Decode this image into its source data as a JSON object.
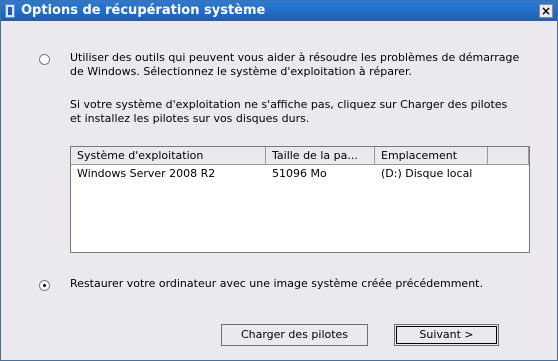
{
  "window": {
    "title": "Options de récupération système",
    "close_label": "×"
  },
  "option1": {
    "selected": false,
    "lines": [
      "Utiliser des outils qui peuvent vous aider à résoudre les problèmes de démarrage",
      "de Windows. Sélectionnez le système d'exploitation à réparer."
    ],
    "note_lines": [
      "Si votre système d'exploitation ne s'affiche pas, cliquez sur Charger des pilotes",
      "et installez les pilotes sur vos disques durs."
    ]
  },
  "os_list": {
    "columns": [
      "Système d'exploitation",
      "Taille de la pa...",
      "Emplacement"
    ],
    "rows": [
      [
        "Windows Server 2008 R2",
        "51096 Mo",
        "(D:) Disque local"
      ]
    ]
  },
  "option2": {
    "selected": true,
    "label": "Restaurer votre ordinateur avec une image système créée précédemment."
  },
  "buttons": {
    "load_drivers": "Charger des pilotes",
    "next": "Suivant >"
  }
}
